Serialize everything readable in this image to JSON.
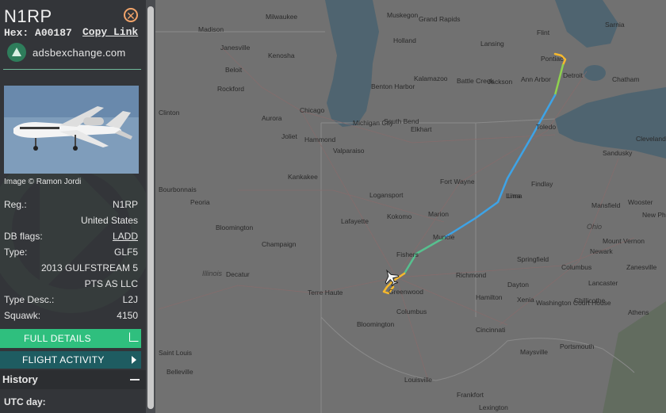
{
  "aircraft": {
    "callsign": "N1RP",
    "hex_label": "Hex:",
    "hex": "A00187",
    "copy_link_label": "Copy Link",
    "site_name": "adsbexchange.com",
    "photo_credit": "Image © Ramon Jordi"
  },
  "details": {
    "reg_label": "Reg.:",
    "reg": "N1RP",
    "country": "United States",
    "db_flags_label": "DB flags:",
    "db_flags": "LADD",
    "type_label": "Type:",
    "type": "GLF5",
    "model": "2013 GULFSTREAM 5",
    "operator": "PTS AS LLC",
    "type_desc_label": "Type Desc.:",
    "type_desc": "L2J",
    "squawk_label": "Squawk:",
    "squawk": "4150"
  },
  "buttons": {
    "full_details": "FULL DETAILS",
    "flight_activity": "FLIGHT ACTIVITY"
  },
  "history": {
    "title": "History",
    "utc_day_label": "UTC day:"
  },
  "map": {
    "cities": [
      "Milwaukee",
      "Madison",
      "Janesville",
      "Kenosha",
      "Beloit",
      "Rockford",
      "Clinton",
      "Aurora",
      "Chicago",
      "Michigan City",
      "Joliet",
      "Hammond",
      "Valparaiso",
      "Kankakee",
      "Bourbonnais",
      "Peoria",
      "Bloomington",
      "Champaign",
      "Decatur",
      "Terre Haute",
      "Lafayette",
      "Kokomo",
      "Logansport",
      "Marion",
      "Muncie",
      "Fishers",
      "Greenwood",
      "Columbus",
      "Bloomington",
      "Richmond",
      "Fort Wayne",
      "Lima",
      "Findlay",
      "Toledo",
      "Detroit",
      "Ann Arbor",
      "Jackson",
      "Lansing",
      "Battle Creek",
      "Kalamazoo",
      "Benton Harbor",
      "South Bend",
      "Elkhart",
      "Muskegon",
      "Grand Rapids",
      "Holland",
      "Flint",
      "Sarnia",
      "Chatham",
      "Cleveland",
      "Sandusky",
      "Mansfield",
      "Wooster",
      "New Phila",
      "Ohio",
      "Springfield",
      "Dayton",
      "Xenia",
      "Columbus",
      "Newark",
      "Zanesville",
      "Lancaster",
      "Chillicothe",
      "Washington Court House",
      "Athens",
      "Portsmouth",
      "Cincinnati",
      "Hamilton",
      "Maysville",
      "Louisville",
      "Frankfort",
      "Lexington",
      "Belleville",
      "Saint Louis",
      "Illinois",
      "Pontiac",
      "Lima",
      "Mount Vernon"
    ],
    "city_ids": [
      "milwaukee",
      "madison",
      "janesville",
      "kenosha",
      "beloit",
      "rockford",
      "clinton",
      "aurora",
      "chicago",
      "michigan-city",
      "joliet",
      "hammond",
      "valparaiso",
      "kankakee",
      "bourbonnais",
      "peoria",
      "bloomington-il",
      "champaign",
      "decatur",
      "terre-haute",
      "lafayette",
      "kokomo",
      "logansport",
      "marion",
      "muncie",
      "fishers",
      "greenwood",
      "columbus-in",
      "bloomington-in",
      "richmond",
      "fort-wayne",
      "lima",
      "findlay",
      "toledo",
      "detroit",
      "ann-arbor",
      "jackson",
      "lansing",
      "battle-creek",
      "kalamazoo",
      "benton-harbor",
      "south-bend",
      "elkhart",
      "muskegon",
      "grand-rapids",
      "holland",
      "flint",
      "sarnia",
      "chatham",
      "cleveland",
      "sandusky",
      "mansfield",
      "wooster",
      "new-phila",
      "ohio-label",
      "springfield",
      "dayton",
      "xenia",
      "columbus-oh",
      "newark",
      "zanesville",
      "lancaster",
      "chillicothe",
      "washington-ch",
      "athens",
      "portsmouth",
      "cincinnati",
      "hamilton",
      "maysville",
      "louisville",
      "frankfort",
      "lexington",
      "belleville",
      "saint-louis",
      "illinois-label",
      "pontiac",
      "lima2",
      "mount-vernon"
    ]
  },
  "colors": {
    "sidebar_bg": "#333539",
    "full_details_bg": "#2fbf7e",
    "flight_activity_bg": "#1e5c61",
    "close_icon": "#f2a46a",
    "track_blue": "#3ea3e6",
    "track_green": "#8fd14f",
    "track_yellow": "#f5b82e"
  }
}
